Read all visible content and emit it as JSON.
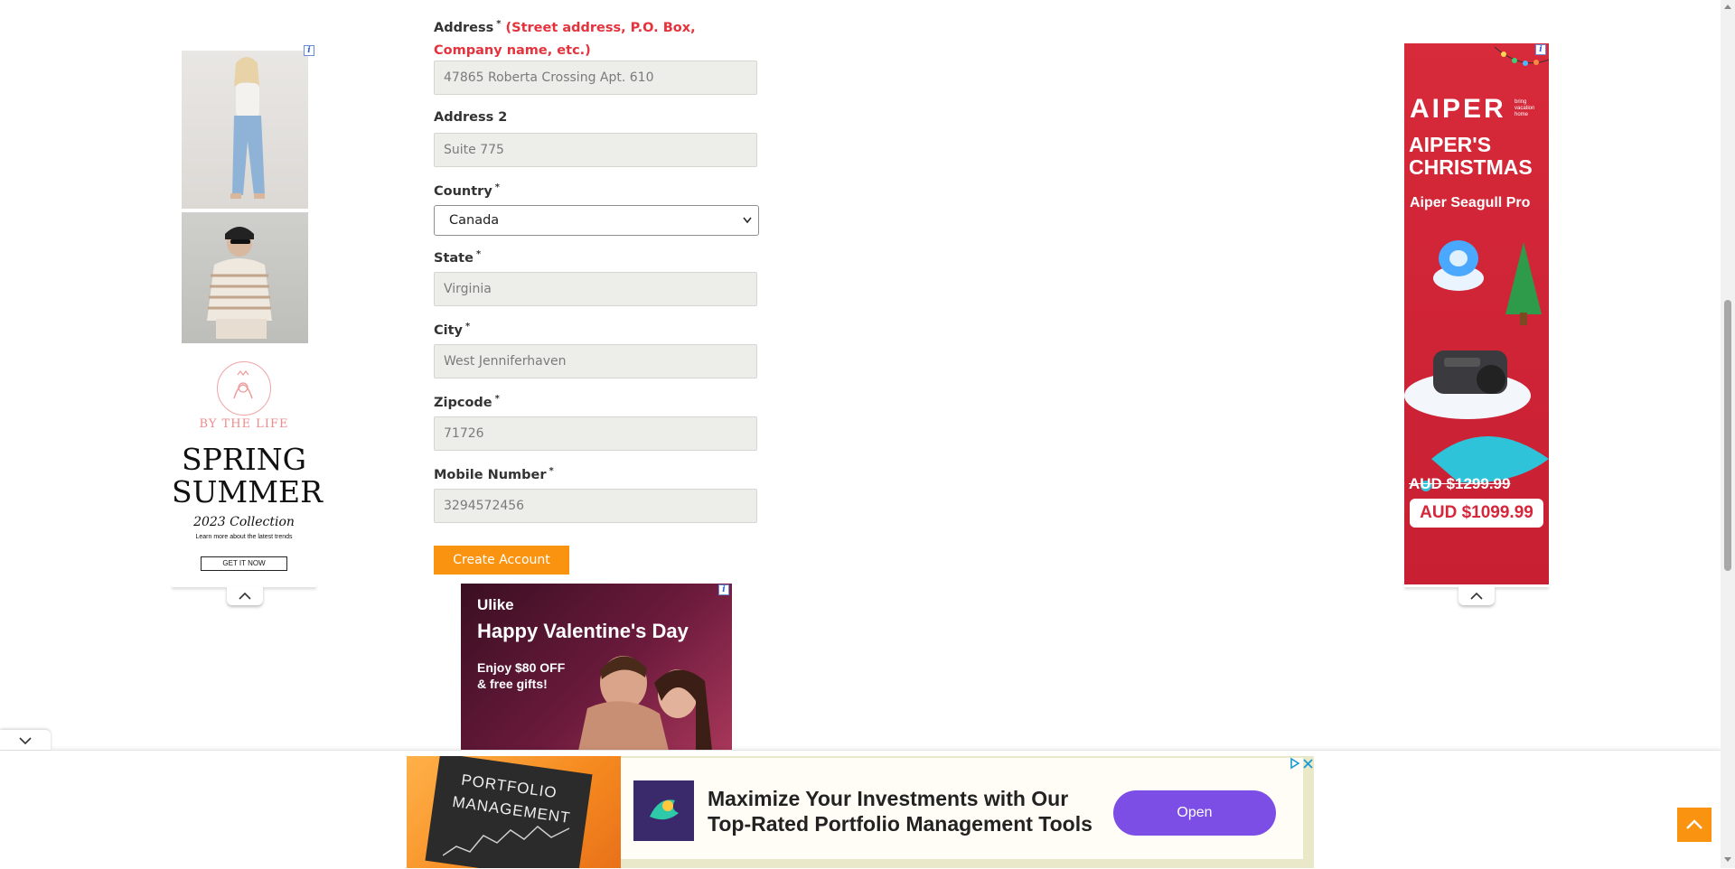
{
  "form": {
    "address": {
      "label": "Address",
      "note": "(Street address, P.O. Box, Company name, etc.)",
      "value": "47865 Roberta Crossing Apt. 610"
    },
    "address2": {
      "label": "Address 2",
      "value": "Suite 775"
    },
    "country": {
      "label": "Country",
      "value": "Canada"
    },
    "state": {
      "label": "State",
      "value": "Virginia"
    },
    "city": {
      "label": "City",
      "value": "West Jenniferhaven"
    },
    "zipcode": {
      "label": "Zipcode",
      "value": "71726"
    },
    "mobile": {
      "label": "Mobile Number",
      "value": "3294572456"
    },
    "required_mark": "*",
    "submit_label": "Create Account"
  },
  "left_ad": {
    "brand": "BY THE LIFE",
    "headline1": "SPRING",
    "headline2": "SUMMER",
    "subheadline": "2023 Collection",
    "tagline": "Learn more about the latest trends",
    "cta": "GET IT NOW",
    "badge": "i"
  },
  "right_ad": {
    "brand": "AIPER",
    "brand_tag": "bring vacation home",
    "headline": "AIPER'S CHRISTMAS",
    "product": "Aiper Seagull Pro",
    "old_price": "AUD $1299.99",
    "new_price": "AUD $1099.99",
    "badge": "i"
  },
  "center_ad": {
    "brand": "Ulike",
    "headline": "Happy Valentine's Day",
    "offer_line1": "Enjoy $80 OFF",
    "offer_line2": "& free gifts!",
    "badge": "i"
  },
  "bottom_ad": {
    "image_text1": "PORTFOLIO",
    "image_text2": "MANAGEMENT",
    "headline_line1": "Maximize Your Investments with Our",
    "headline_line2": "Top-Rated Portfolio Management Tools",
    "cta": "Open",
    "colors": {
      "background": "#e9e8c8",
      "cta": "#7c4ee6"
    }
  },
  "colors": {
    "accent": "#fa9310",
    "required_note": "#e5333d",
    "scroll_top": "#fa9310"
  },
  "icons": [
    "chevron-up-icon",
    "chevron-down-icon",
    "arrow-up-icon",
    "close-icon",
    "adchoices-icon"
  ]
}
